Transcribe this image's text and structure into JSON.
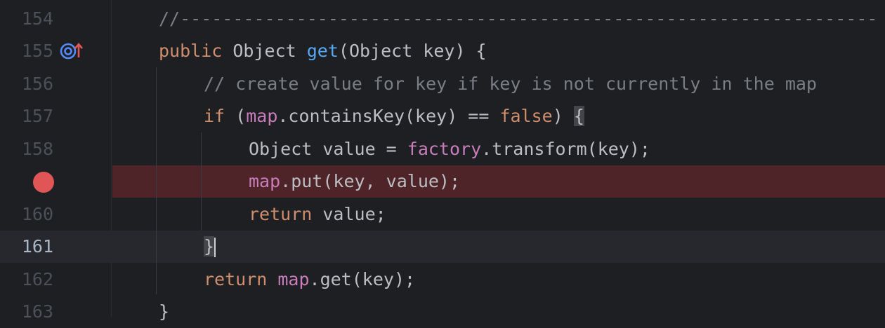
{
  "editor": {
    "lines": [
      {
        "num": "154",
        "text": "//------------------------------------------------------------------"
      },
      {
        "num": "155",
        "text_parts": [
          "public",
          " Object ",
          "get",
          "(Object key) {"
        ]
      },
      {
        "num": "156",
        "text": "// create value for key if key is not currently in the map"
      },
      {
        "num": "157",
        "text_parts": [
          "if",
          " (",
          "map",
          ".containsKey(key) == ",
          "false",
          ") ",
          "{"
        ]
      },
      {
        "num": "158",
        "text_parts": [
          "Object value = ",
          "factory",
          ".transform(key);"
        ]
      },
      {
        "num": "",
        "text_parts": [
          "map",
          ".put(key, value);"
        ]
      },
      {
        "num": "160",
        "text_parts": [
          "return",
          " value;"
        ]
      },
      {
        "num": "161",
        "text_parts": [
          "}"
        ]
      },
      {
        "num": "162",
        "text_parts": [
          "return",
          " ",
          "map",
          ".get(key);"
        ]
      },
      {
        "num": "163",
        "text_parts": [
          "}"
        ]
      }
    ],
    "current_line": "161",
    "breakpoint_line_index": 5,
    "colors": {
      "background": "#1e1f22",
      "keyword": "#cf8e6d",
      "function": "#56a8f5",
      "field": "#c77dbb",
      "comment": "#7a7e85",
      "breakpoint": "#e05555"
    },
    "icons": [
      "implementing-method-icon",
      "breakpoint-icon"
    ]
  }
}
